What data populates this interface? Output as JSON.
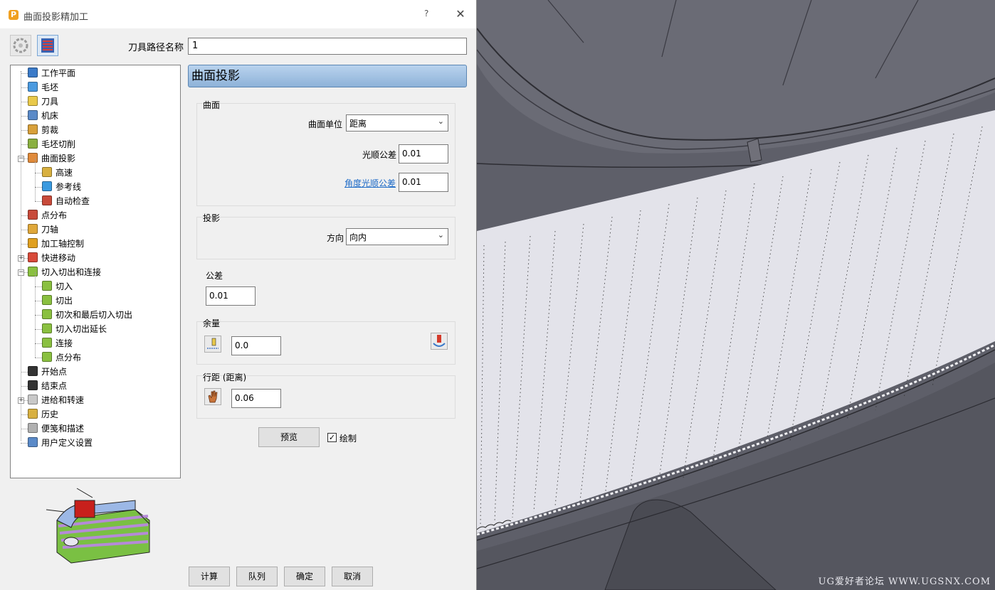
{
  "window": {
    "title": "曲面投影精加工",
    "help": "?",
    "close": "✕"
  },
  "toolpath": {
    "name_label": "刀具路径名称",
    "name_value": "1"
  },
  "tree": [
    {
      "label": "工作平面",
      "icon": "workplane-icon",
      "level": 0
    },
    {
      "label": "毛坯",
      "icon": "block-icon",
      "level": 0
    },
    {
      "label": "刀具",
      "icon": "tool-icon",
      "level": 0
    },
    {
      "label": "机床",
      "icon": "machine-icon",
      "level": 0
    },
    {
      "label": "剪裁",
      "icon": "limit-icon",
      "level": 0
    },
    {
      "label": "毛坯切削",
      "icon": "stock-cut-icon",
      "level": 0
    },
    {
      "label": "曲面投影",
      "icon": "surface-projection-icon",
      "level": 0,
      "expander": "−"
    },
    {
      "label": "高速",
      "icon": "high-speed-icon",
      "level": 1
    },
    {
      "label": "参考线",
      "icon": "reference-line-icon",
      "level": 1
    },
    {
      "label": "自动检查",
      "icon": "auto-check-icon",
      "level": 1
    },
    {
      "label": "点分布",
      "icon": "point-distribution-icon",
      "level": 0
    },
    {
      "label": "刀轴",
      "icon": "tool-axis-icon",
      "level": 0
    },
    {
      "label": "加工轴控制",
      "icon": "axis-control-icon",
      "level": 0
    },
    {
      "label": "快进移动",
      "icon": "rapid-move-icon",
      "level": 0,
      "expander": "+"
    },
    {
      "label": "切入切出和连接",
      "icon": "leads-links-icon",
      "level": 0,
      "expander": "−"
    },
    {
      "label": "切入",
      "icon": "lead-in-icon",
      "level": 1
    },
    {
      "label": "切出",
      "icon": "lead-out-icon",
      "level": 1
    },
    {
      "label": "初次和最后切入切出",
      "icon": "first-last-icon",
      "level": 1
    },
    {
      "label": "切入切出延长",
      "icon": "extension-icon",
      "level": 1
    },
    {
      "label": "连接",
      "icon": "links-icon",
      "level": 1
    },
    {
      "label": "点分布",
      "icon": "link-point-distribution-icon",
      "level": 1
    },
    {
      "label": "开始点",
      "icon": "start-point-icon",
      "level": 0
    },
    {
      "label": "结束点",
      "icon": "end-point-icon",
      "level": 0
    },
    {
      "label": "进给和转速",
      "icon": "feeds-speeds-icon",
      "level": 0,
      "expander": "+"
    },
    {
      "label": "历史",
      "icon": "history-icon",
      "level": 0
    },
    {
      "label": "便笺和描述",
      "icon": "notes-icon",
      "level": 0
    },
    {
      "label": "用户定义设置",
      "icon": "user-settings-icon",
      "level": 0
    }
  ],
  "panel": {
    "header": "曲面投影",
    "surface": {
      "title": "曲面",
      "units_label": "曲面单位",
      "units_value": "距离",
      "smoothing_label": "光顺公差",
      "smoothing_value": "0.01",
      "angular_label": "角度光顺公差",
      "angular_value": "0.01"
    },
    "projection": {
      "title": "投影",
      "direction_label": "方向",
      "direction_value": "向内"
    },
    "tolerance": {
      "label": "公差",
      "value": "0.01"
    },
    "thickness": {
      "label": "余量",
      "value": "0.0"
    },
    "stepover": {
      "label": "行距 (距离)",
      "value": "0.06"
    },
    "preview_label": "预览",
    "draw_label": "绘制",
    "draw_checked": "✓"
  },
  "footer": {
    "calculate": "计算",
    "queue": "队列",
    "ok": "确定",
    "cancel": "取消"
  },
  "viewport": {
    "watermark": "UG爱好者论坛 WWW.UGSNX.COM"
  },
  "colors": {
    "header_blue": "#9cbce0",
    "link": "#1c6ac7",
    "model_gray": "#5c5c66",
    "sheet": "#e2e2ea"
  }
}
